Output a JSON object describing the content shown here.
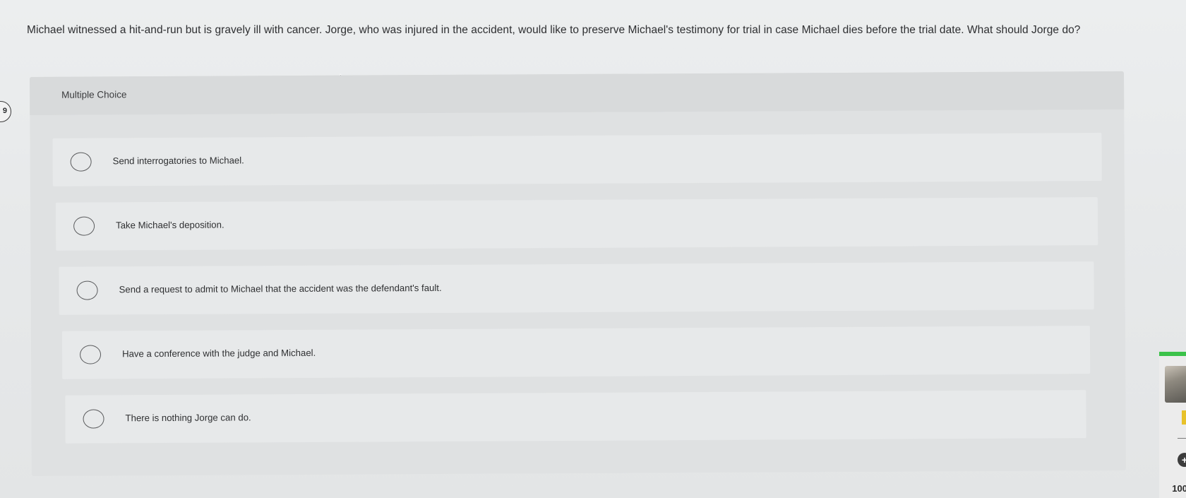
{
  "question": {
    "number": "9",
    "text": "Michael witnessed a hit-and-run but is gravely ill with cancer. Jorge, who was injured in the accident, would like to preserve Michael's testimony for trial in case Michael dies before the trial date. What should Jorge do?"
  },
  "multiple_choice": {
    "title": "Multiple Choice",
    "options": [
      {
        "label": "Send interrogatories to Michael."
      },
      {
        "label": "Take Michael's deposition."
      },
      {
        "label": "Send a request to admit to Michael that the accident was the defendant's fault."
      },
      {
        "label": "Have a conference with the judge and Michael."
      },
      {
        "label": "There is nothing Jorge can do."
      }
    ]
  },
  "side_widget": {
    "zoom": "100",
    "plus_icon": "plus-circle-icon",
    "accent_color": "#3cc24a"
  }
}
